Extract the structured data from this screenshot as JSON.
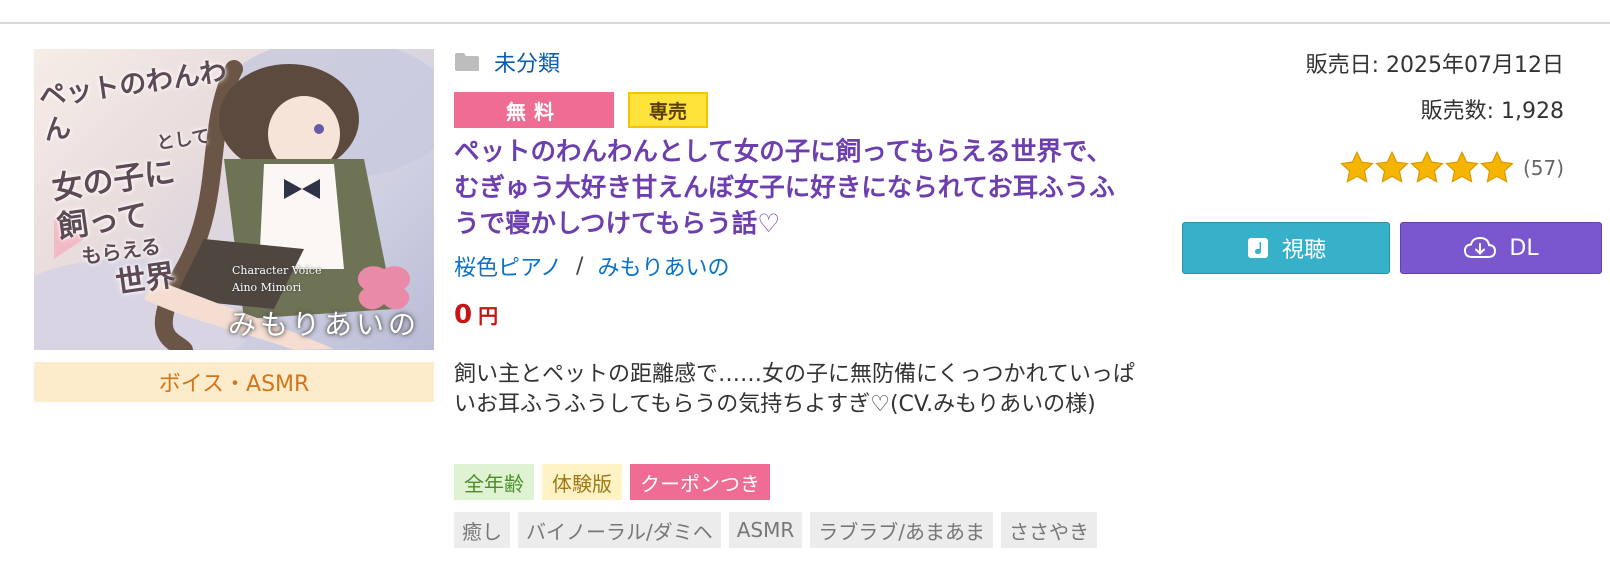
{
  "thumbnail": {
    "title_lines": [
      "ペットのわんわん",
      "として",
      "女の子に",
      "飼って",
      "もらえる",
      "世界"
    ],
    "cv_lines": [
      "Character Voice",
      "Aino Mimori"
    ],
    "cv_name": "みもりあいの"
  },
  "category": "ボイス・ASMR",
  "folder_label": "未分類",
  "badges": {
    "free": "無料",
    "exclusive": "専売"
  },
  "title": "ペットのわんわんとして女の子に飼ってもらえる世界で、むぎゅう大好き甘えんぼ女子に好きになられてお耳ふうふうで寝かしつけてもらう話♡",
  "circle": {
    "name": "桜色ピアノ",
    "separator": "/",
    "voice_actor": "みもりあいの"
  },
  "price": {
    "value": "0",
    "unit": "円"
  },
  "description": "飼い主とペットの距離感で……女の子に無防備にくっつかれていっぱいお耳ふうふうしてもらうの気持ちよすぎ♡(CV.みもりあいの様)",
  "flags": [
    "全年齢",
    "体験版",
    "クーポンつき"
  ],
  "tags": [
    "癒し",
    "バイノーラル/ダミヘ",
    "ASMR",
    "ラブラブ/あまあま",
    "ささやき"
  ],
  "release_date": "販売日: 2025年07月12日",
  "sales_count": "販売数: 1,928",
  "rating": {
    "stars": 5,
    "count": "(57)"
  },
  "buttons": {
    "listen": "視聴",
    "download": "DL"
  },
  "colors": {
    "title": "#6d3fae",
    "link": "#0b72c9",
    "price": "#c81414",
    "free_badge": "#ef6c93",
    "exclusive_badge": "#ffe33a",
    "listen_button": "#37b1c9",
    "download_button": "#7a56cf",
    "star": "#f5b400"
  }
}
